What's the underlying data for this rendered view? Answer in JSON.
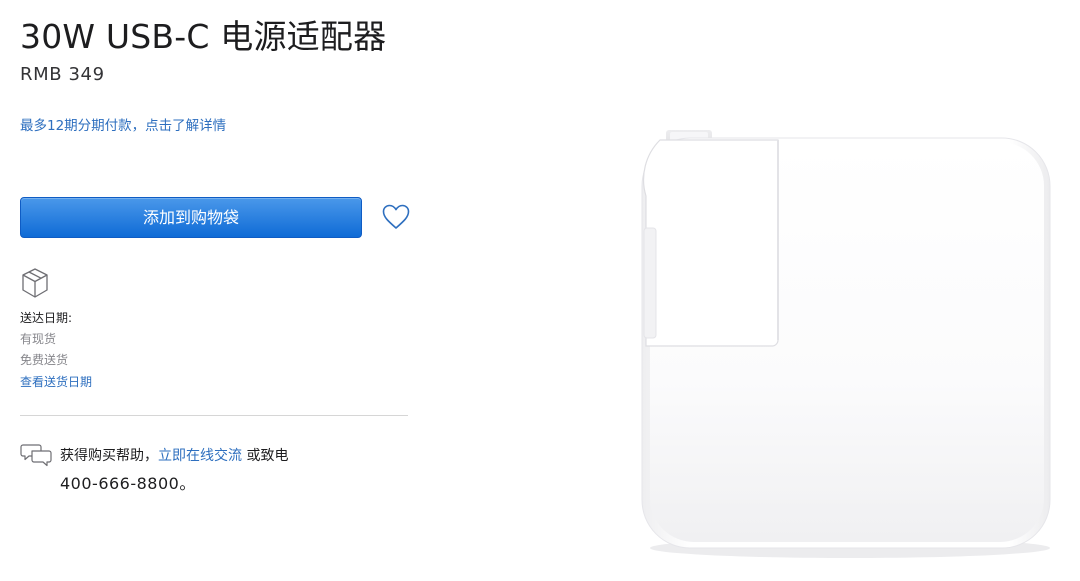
{
  "product": {
    "title": "30W USB-C 电源适配器",
    "price": "RMB 349",
    "installment_link": "最多12期分期付款，点击了解详情"
  },
  "actions": {
    "add_to_bag_label": "添加到购物袋",
    "favorite_icon": "heart-icon"
  },
  "delivery": {
    "icon": "box-icon",
    "label": "送达日期:",
    "stock": "有现货",
    "shipping": "免费送货",
    "check_link": "查看送货日期"
  },
  "help": {
    "icon": "chat-bubbles-icon",
    "prefix": "获得购买帮助，",
    "chat_link": "立即在线交流",
    "suffix": " 或致电",
    "phone": "400-666-8800。"
  },
  "colors": {
    "link": "#2e6fbf",
    "button_top": "#4a98ea",
    "button_bottom": "#0f6bd6"
  }
}
